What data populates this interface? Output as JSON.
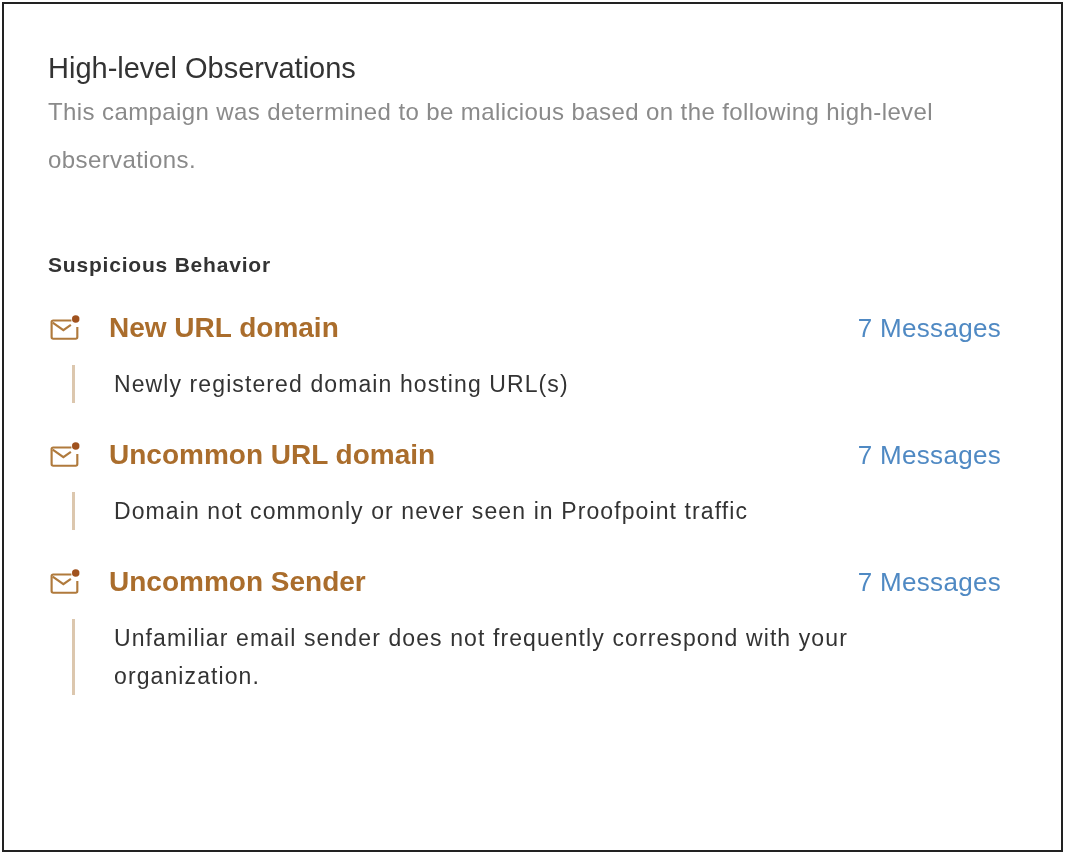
{
  "title": "High-level Observations",
  "description": "This campaign was determined to be malicious based on the following high-level observations.",
  "section": "Suspicious Behavior",
  "observations": [
    {
      "name": "New URL domain",
      "count": "7 Messages",
      "detail": "Newly registered domain hosting URL(s)"
    },
    {
      "name": "Uncommon URL domain",
      "count": "7 Messages",
      "detail": "Domain not commonly or never seen in Proofpoint traffic"
    },
    {
      "name": "Uncommon Sender",
      "count": "7 Messages",
      "detail": "Unfamiliar email sender does not frequently correspond with your organization."
    }
  ]
}
